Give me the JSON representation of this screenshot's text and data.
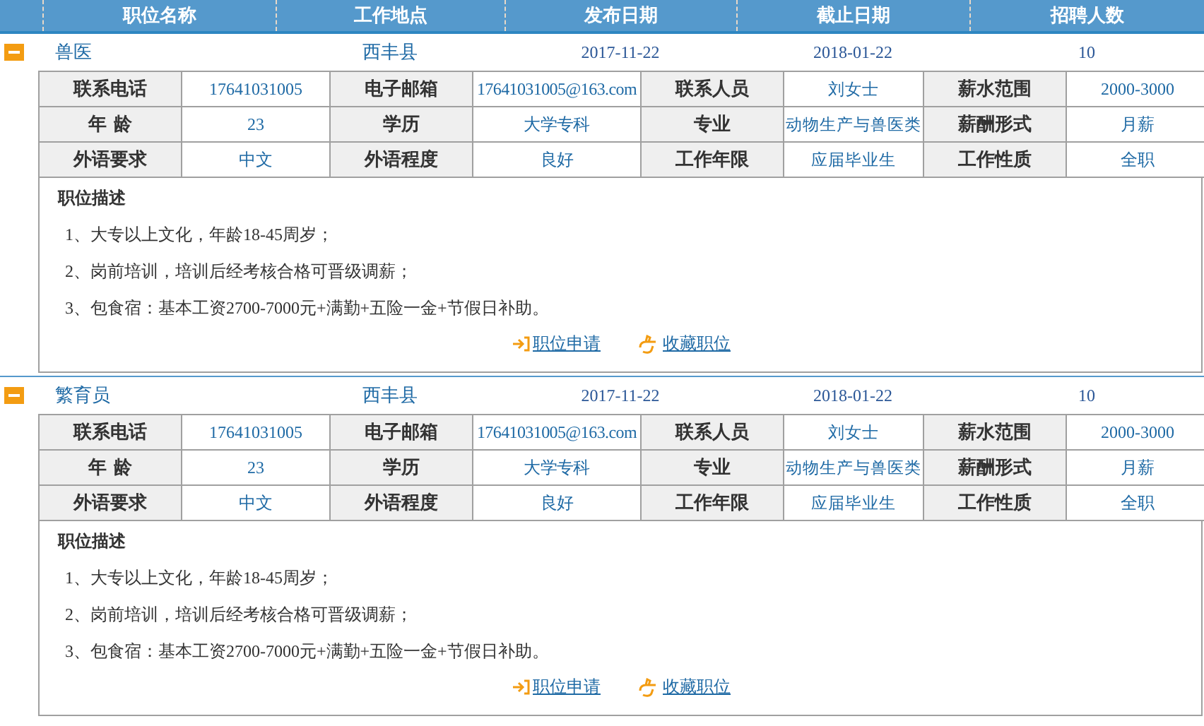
{
  "table": {
    "columns": [
      "职位名称",
      "工作地点",
      "发布日期",
      "截止日期",
      "招聘人数"
    ],
    "jobs": [
      {
        "expanded": true,
        "title": "兽医",
        "location": "西丰县",
        "published": "2017-11-22",
        "deadline": "2018-01-22",
        "openings": "10",
        "details": [
          [
            {
              "label": "联系电话",
              "value": "17641031005"
            },
            {
              "label": "电子邮箱",
              "value": "17641031005@163.com"
            },
            {
              "label": "联系人员",
              "value": "刘女士"
            },
            {
              "label": "薪水范围",
              "value": "2000-3000"
            }
          ],
          [
            {
              "label": "年 龄",
              "value": "23"
            },
            {
              "label": "学历",
              "value": "大学专科"
            },
            {
              "label": "专业",
              "value": "动物生产与兽医类"
            },
            {
              "label": "薪酬形式",
              "value": "月薪"
            }
          ],
          [
            {
              "label": "外语要求",
              "value": "中文"
            },
            {
              "label": "外语程度",
              "value": "良好"
            },
            {
              "label": "工作年限",
              "value": "应届毕业生"
            },
            {
              "label": "工作性质",
              "value": "全职"
            }
          ]
        ],
        "description_title": "职位描述",
        "description": [
          "1、大专以上文化，年龄18-45周岁；",
          "2、岗前培训，培训后经考核合格可晋级调薪；",
          "3、包食宿：基本工资2700-7000元+满勤+五险一金+节假日补助。"
        ],
        "apply": "职位申请",
        "favorite": "收藏职位"
      },
      {
        "expanded": true,
        "title": "繁育员",
        "location": "西丰县",
        "published": "2017-11-22",
        "deadline": "2018-01-22",
        "openings": "10",
        "details": [
          [
            {
              "label": "联系电话",
              "value": "17641031005"
            },
            {
              "label": "电子邮箱",
              "value": "17641031005@163.com"
            },
            {
              "label": "联系人员",
              "value": "刘女士"
            },
            {
              "label": "薪水范围",
              "value": "2000-3000"
            }
          ],
          [
            {
              "label": "年 龄",
              "value": "23"
            },
            {
              "label": "学历",
              "value": "大学专科"
            },
            {
              "label": "专业",
              "value": "动物生产与兽医类"
            },
            {
              "label": "薪酬形式",
              "value": "月薪"
            }
          ],
          [
            {
              "label": "外语要求",
              "value": "中文"
            },
            {
              "label": "外语程度",
              "value": "良好"
            },
            {
              "label": "工作年限",
              "value": "应届毕业生"
            },
            {
              "label": "工作性质",
              "value": "全职"
            }
          ]
        ],
        "description_title": "职位描述",
        "description": [
          "1、大专以上文化，年龄18-45周岁；",
          "2、岗前培训，培训后经考核合格可晋级调薪；",
          "3、包食宿：基本工资2700-7000元+满勤+五险一金+节假日补助。"
        ],
        "apply": "职位申请",
        "favorite": "收藏职位"
      }
    ]
  }
}
